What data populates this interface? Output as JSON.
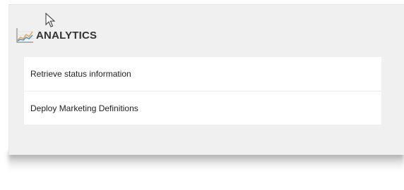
{
  "tile": {
    "title": "ANALYTICS",
    "icon": "line-chart-icon",
    "items": [
      {
        "label": "Retrieve status information"
      },
      {
        "label": "Deploy Marketing Definitions"
      }
    ]
  },
  "colors": {
    "tile_background": "#f0f0f0",
    "item_background": "#ffffff",
    "title_text": "#333333",
    "icon_line_blue": "#3a8ed6",
    "icon_line_orange": "#e8a33c"
  },
  "cursor": "arrow-cursor-icon"
}
